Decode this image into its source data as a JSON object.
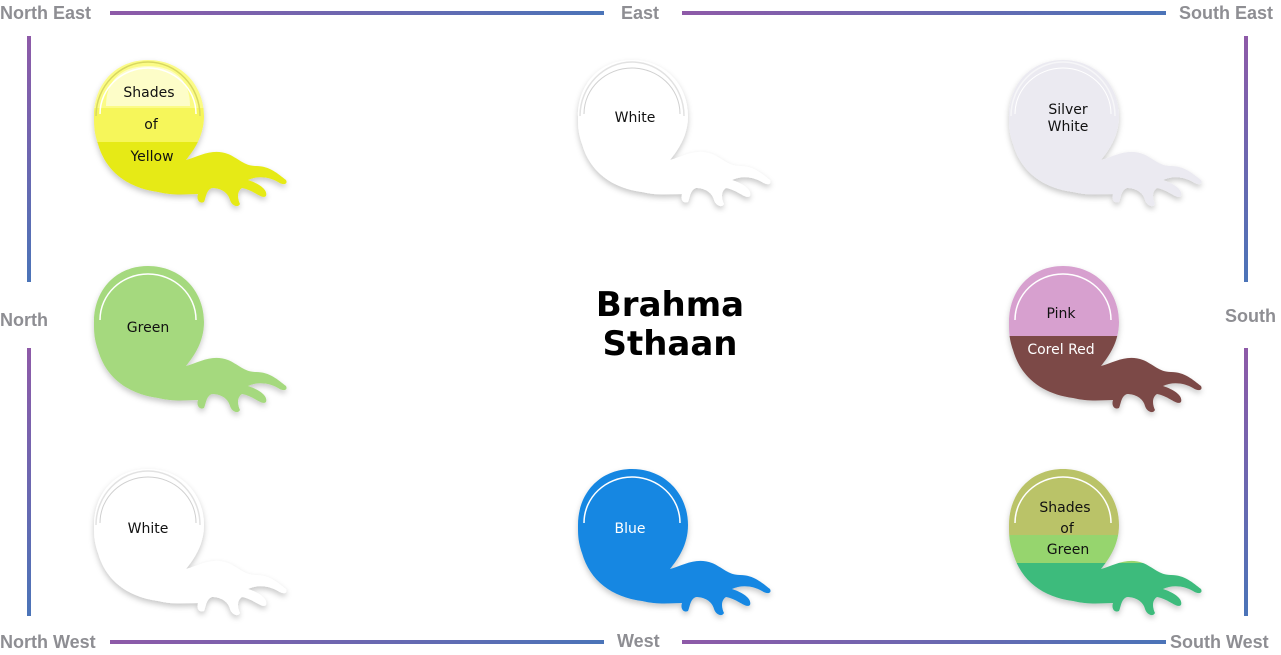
{
  "directions": {
    "north_east": "North East",
    "east": "East",
    "south_east": "South East",
    "north": "North",
    "south": "South",
    "north_west": "North West",
    "west": "West",
    "south_west": "South West"
  },
  "center": {
    "line1": "Brahma",
    "line2": "Sthaan"
  },
  "colors": {
    "line_start": "#8e5aa8",
    "line_end": "#4b74b8",
    "yellow_light": "#fbfb86",
    "yellow_mid": "#f6f65a",
    "yellow_dark": "#e6ea12",
    "white": "#ffffff",
    "silver_white": "#ebeaf1",
    "green": "#a5d97e",
    "pink": "#d7a0cf",
    "corel_red": "#7b4a46",
    "blue": "#1587e2",
    "green_1": "#bac368",
    "green_2": "#96d56e",
    "green_3": "#3dbb7b"
  },
  "paints": {
    "north_east": {
      "line1": "Shades",
      "line2": "of",
      "line3": "Yellow"
    },
    "east": {
      "label": "White"
    },
    "south_east": {
      "line1": "Silver",
      "line2": "White"
    },
    "north": {
      "label": "Green"
    },
    "south": {
      "top": "Pink",
      "bottom": "Corel Red"
    },
    "north_west": {
      "label": "White"
    },
    "west": {
      "label": "Blue"
    },
    "south_west": {
      "line1": "Shades",
      "line2": "of",
      "line3": "Green"
    }
  }
}
